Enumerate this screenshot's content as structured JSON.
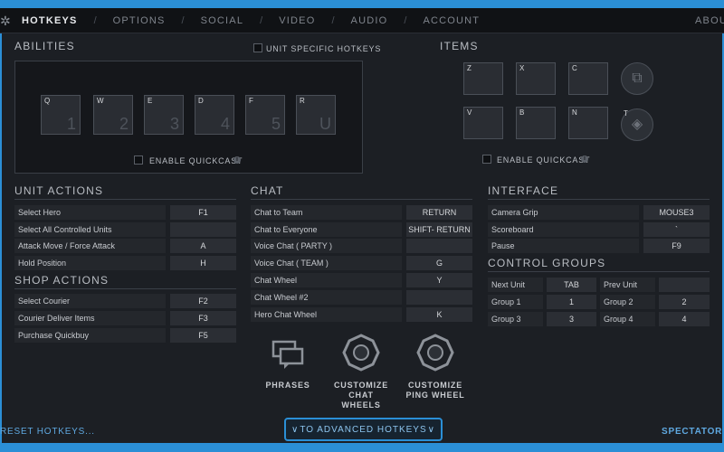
{
  "nav": {
    "tabs": [
      {
        "label": "HOTKEYS",
        "active": true
      },
      {
        "label": "OPTIONS",
        "active": false
      },
      {
        "label": "SOCIAL",
        "active": false
      },
      {
        "label": "VIDEO",
        "active": false
      },
      {
        "label": "AUDIO",
        "active": false
      },
      {
        "label": "ACCOUNT",
        "active": false
      }
    ],
    "about": "ABOU"
  },
  "abilities": {
    "title": "ABILITIES",
    "unit_specific_label": "UNIT SPECIFIC HOTKEYS",
    "slots": [
      {
        "key": "Q",
        "num": "1"
      },
      {
        "key": "W",
        "num": "2"
      },
      {
        "key": "E",
        "num": "3"
      },
      {
        "key": "D",
        "num": "4"
      },
      {
        "key": "F",
        "num": "5"
      },
      {
        "key": "R",
        "num": "U"
      }
    ],
    "quickcast_label": "ENABLE QUICKCAST"
  },
  "items": {
    "title": "ITEMS",
    "slots": [
      {
        "key": "Z"
      },
      {
        "key": "X"
      },
      {
        "key": "C"
      },
      {
        "key": "V"
      },
      {
        "key": "B"
      },
      {
        "key": "N"
      }
    ],
    "neutral_key": "T",
    "quickcast_label": "ENABLE QUICKCAST"
  },
  "unit_actions": {
    "title": "UNIT ACTIONS",
    "rows": [
      {
        "label": "Select Hero",
        "key": "F1"
      },
      {
        "label": "Select All Controlled Units",
        "key": ""
      },
      {
        "label": "Attack Move / Force Attack",
        "key": "A"
      },
      {
        "label": "Hold Position",
        "key": "H"
      }
    ]
  },
  "shop_actions": {
    "title": "SHOP ACTIONS",
    "rows": [
      {
        "label": "Select Courier",
        "key": "F2"
      },
      {
        "label": "Courier Deliver Items",
        "key": "F3"
      },
      {
        "label": "Purchase Quickbuy",
        "key": "F5"
      }
    ]
  },
  "chat": {
    "title": "CHAT",
    "rows": [
      {
        "label": "Chat to Team",
        "key": "RETURN"
      },
      {
        "label": "Chat to Everyone",
        "key": "SHIFT- RETURN"
      },
      {
        "label": "Voice Chat ( PARTY )",
        "key": ""
      },
      {
        "label": "Voice Chat ( TEAM )",
        "key": "G"
      },
      {
        "label": "Chat Wheel",
        "key": "Y"
      },
      {
        "label": "Chat Wheel #2",
        "key": ""
      },
      {
        "label": "Hero Chat Wheel",
        "key": "K"
      }
    ],
    "actions": [
      {
        "label": "PHRASES"
      },
      {
        "label": "CUSTOMIZE CHAT WHEELS"
      },
      {
        "label": "CUSTOMIZE PING WHEEL"
      }
    ]
  },
  "interface": {
    "title": "INTERFACE",
    "rows": [
      {
        "label": "Camera Grip",
        "key": "MOUSE3"
      },
      {
        "label": "Scoreboard",
        "key": "`"
      },
      {
        "label": "Pause",
        "key": "F9"
      }
    ]
  },
  "control_groups": {
    "title": "CONTROL GROUPS",
    "rows": [
      {
        "l1": "Next Unit",
        "k1": "TAB",
        "l2": "Prev Unit",
        "k2": ""
      },
      {
        "l1": "Group 1",
        "k1": "1",
        "l2": "Group 2",
        "k2": "2"
      },
      {
        "l1": "Group 3",
        "k1": "3",
        "l2": "Group 4",
        "k2": "4"
      }
    ]
  },
  "footer": {
    "reset": "RESET HOTKEYS...",
    "advanced": "TO ADVANCED HOTKEYS",
    "spectator": "SPECTATOR X"
  }
}
